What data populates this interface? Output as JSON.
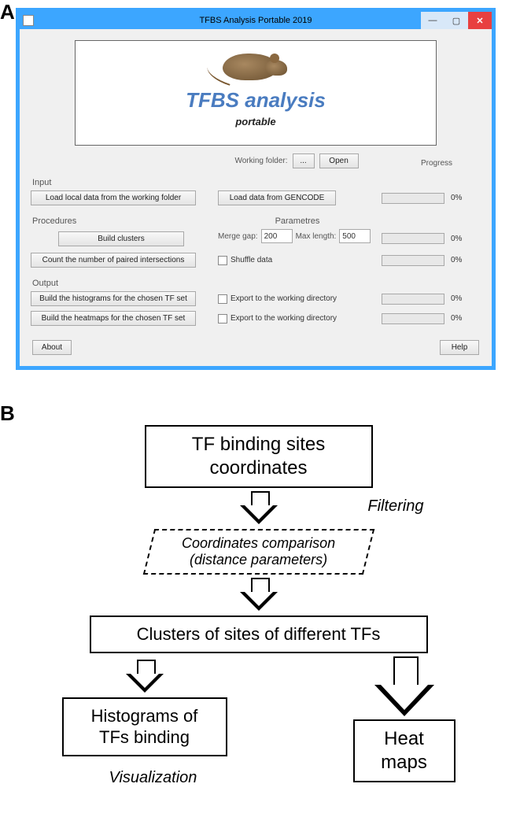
{
  "panelA_label": "A",
  "panelB_label": "B",
  "window": {
    "title": "TFBS Analysis Portable 2019",
    "banner_title": "TFBS analysis",
    "banner_sub": "portable",
    "working_folder_label": "Working folder:",
    "open_label": "Open",
    "browse_label": "...",
    "progress_header": "Progress",
    "input_label": "Input",
    "btn_load_local": "Load local data from the working folder",
    "btn_load_gencode": "Load data from GENCODE",
    "procedures_label": "Procedures",
    "parametres_label": "Parametres",
    "btn_build_clusters": "Build clusters",
    "merge_gap_label": "Merge gap:",
    "merge_gap_value": "200",
    "max_length_label": "Max length:",
    "max_length_value": "500",
    "btn_count_paired": "Count the number of paired intersections",
    "chk_shuffle": "Shuffle data",
    "output_label": "Output",
    "btn_histograms": "Build the histograms for the chosen TF set",
    "btn_heatmaps": "Build the heatmaps for the chosen TF set",
    "chk_export1": "Export to the working directory",
    "chk_export2": "Export to the working directory",
    "about_label": "About",
    "help_label": "Help",
    "pct": "0%"
  },
  "flow": {
    "box_top": "TF binding sites coordinates",
    "filtering": "Filtering",
    "dashed_l1": "Coordinates comparison",
    "dashed_l2": "(distance parameters)",
    "box_clusters": "Clusters of sites of different TFs",
    "box_hist_l1": "Histograms of",
    "box_hist_l2": "TFs binding",
    "box_heat_l1": "Heat",
    "box_heat_l2": "maps",
    "visualization": "Visualization"
  }
}
